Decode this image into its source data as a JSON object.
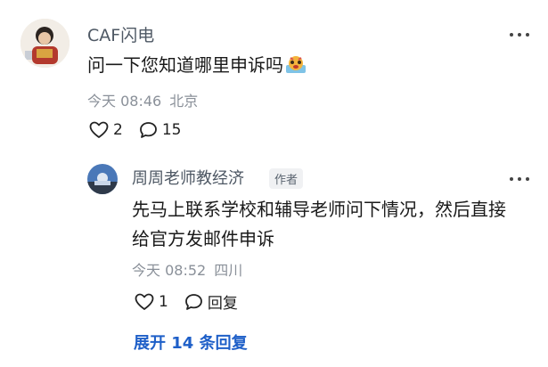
{
  "comment": {
    "username": "CAF闪电",
    "text": "问一下您知道哪里申诉吗",
    "emoji_icon": "crying-face-icon",
    "time": "今天 08:46",
    "location": "北京",
    "likes": "2",
    "replies_count": "15"
  },
  "reply": {
    "username": "周周老师教经济",
    "badge": "作者",
    "text_line1": "先马上联系学校和辅导老师问下情况，然后直接",
    "text_line2": "给官方发邮件申诉",
    "time": "今天 08:52",
    "location": "四川",
    "likes": "1",
    "reply_label": "回复"
  },
  "expand_label": "展开 14 条回复",
  "colors": {
    "link": "#1e5fc8",
    "meta": "#8a9099",
    "name": "#4e5864"
  }
}
